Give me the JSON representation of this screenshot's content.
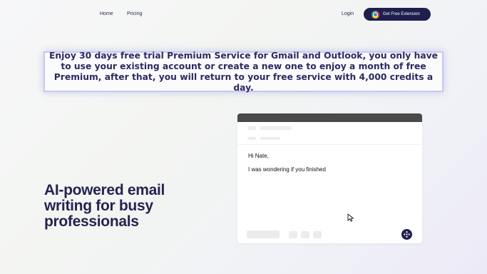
{
  "nav": {
    "home": "Home",
    "pricing": "Pricing",
    "login": "Login",
    "cta_label": "Get Free Extension"
  },
  "banner": {
    "text": "Enjoy 30 days free trial Premium Service for Gmail and Outlook, you only have to use your existing account or create a new one to enjoy a month of free Premium, after that, you will return to your free service with 4,000 credits a day."
  },
  "hero": {
    "title": "AI-powered email writing for busy professionals"
  },
  "email_preview": {
    "greeting": "Hi Nate,",
    "body": "I was wondering if you finished"
  },
  "icons": {
    "cta": "chrome-icon",
    "cursor": "cursor-icon",
    "action": "move-icon"
  },
  "colors": {
    "brand_dark": "#1f1e4f",
    "banner_border": "#c8c8f0",
    "window_bar": "#4a4a4a"
  }
}
